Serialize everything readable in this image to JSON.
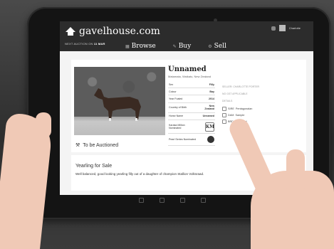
{
  "site": {
    "logo_text": "gavelhouse.com",
    "next_auction_prefix": "NEXT AUCTION ON",
    "next_auction_date": "11 MAR"
  },
  "nav": {
    "browse": "Browse",
    "buy": "Buy",
    "sell": "Sell"
  },
  "user": {
    "name": "Charlotte"
  },
  "listing": {
    "title": "Unnamed",
    "location": "Matamata, Waikato, New Zealand",
    "details": [
      {
        "label": "Sex",
        "value": "Filly"
      },
      {
        "label": "Colour",
        "value": "Bay"
      },
      {
        "label": "Year Foaled",
        "value": "2014"
      },
      {
        "label": "Country of Birth",
        "value": "New Zealand"
      },
      {
        "label": "Horse Name",
        "value": "Unnamed"
      },
      {
        "label": "Karaka Million Nominated",
        "value": ""
      },
      {
        "label": "Pearl Series Nominated",
        "value": ""
      }
    ],
    "auction_label": "To be Auctioned",
    "seller_heading": "SELLER: CHARLOTTE PORTER",
    "vendor_heading": "NO GST APPLICABLE",
    "pedigree_heading": "DETAILS",
    "pedigree": [
      {
        "role": "SIRE",
        "name": "Pentagonalan"
      },
      {
        "role": "DAM",
        "name": "Sample"
      },
      {
        "role": "BRD",
        "name": "Volkstead"
      }
    ]
  },
  "description": {
    "heading": "Yearling for Sale",
    "text": "Well balanced, good looking yearling filly out of a daughter of champion Stallion Volksraad."
  },
  "icons": {
    "logo": "house-logo-icon",
    "gavel": "gavel-icon"
  }
}
